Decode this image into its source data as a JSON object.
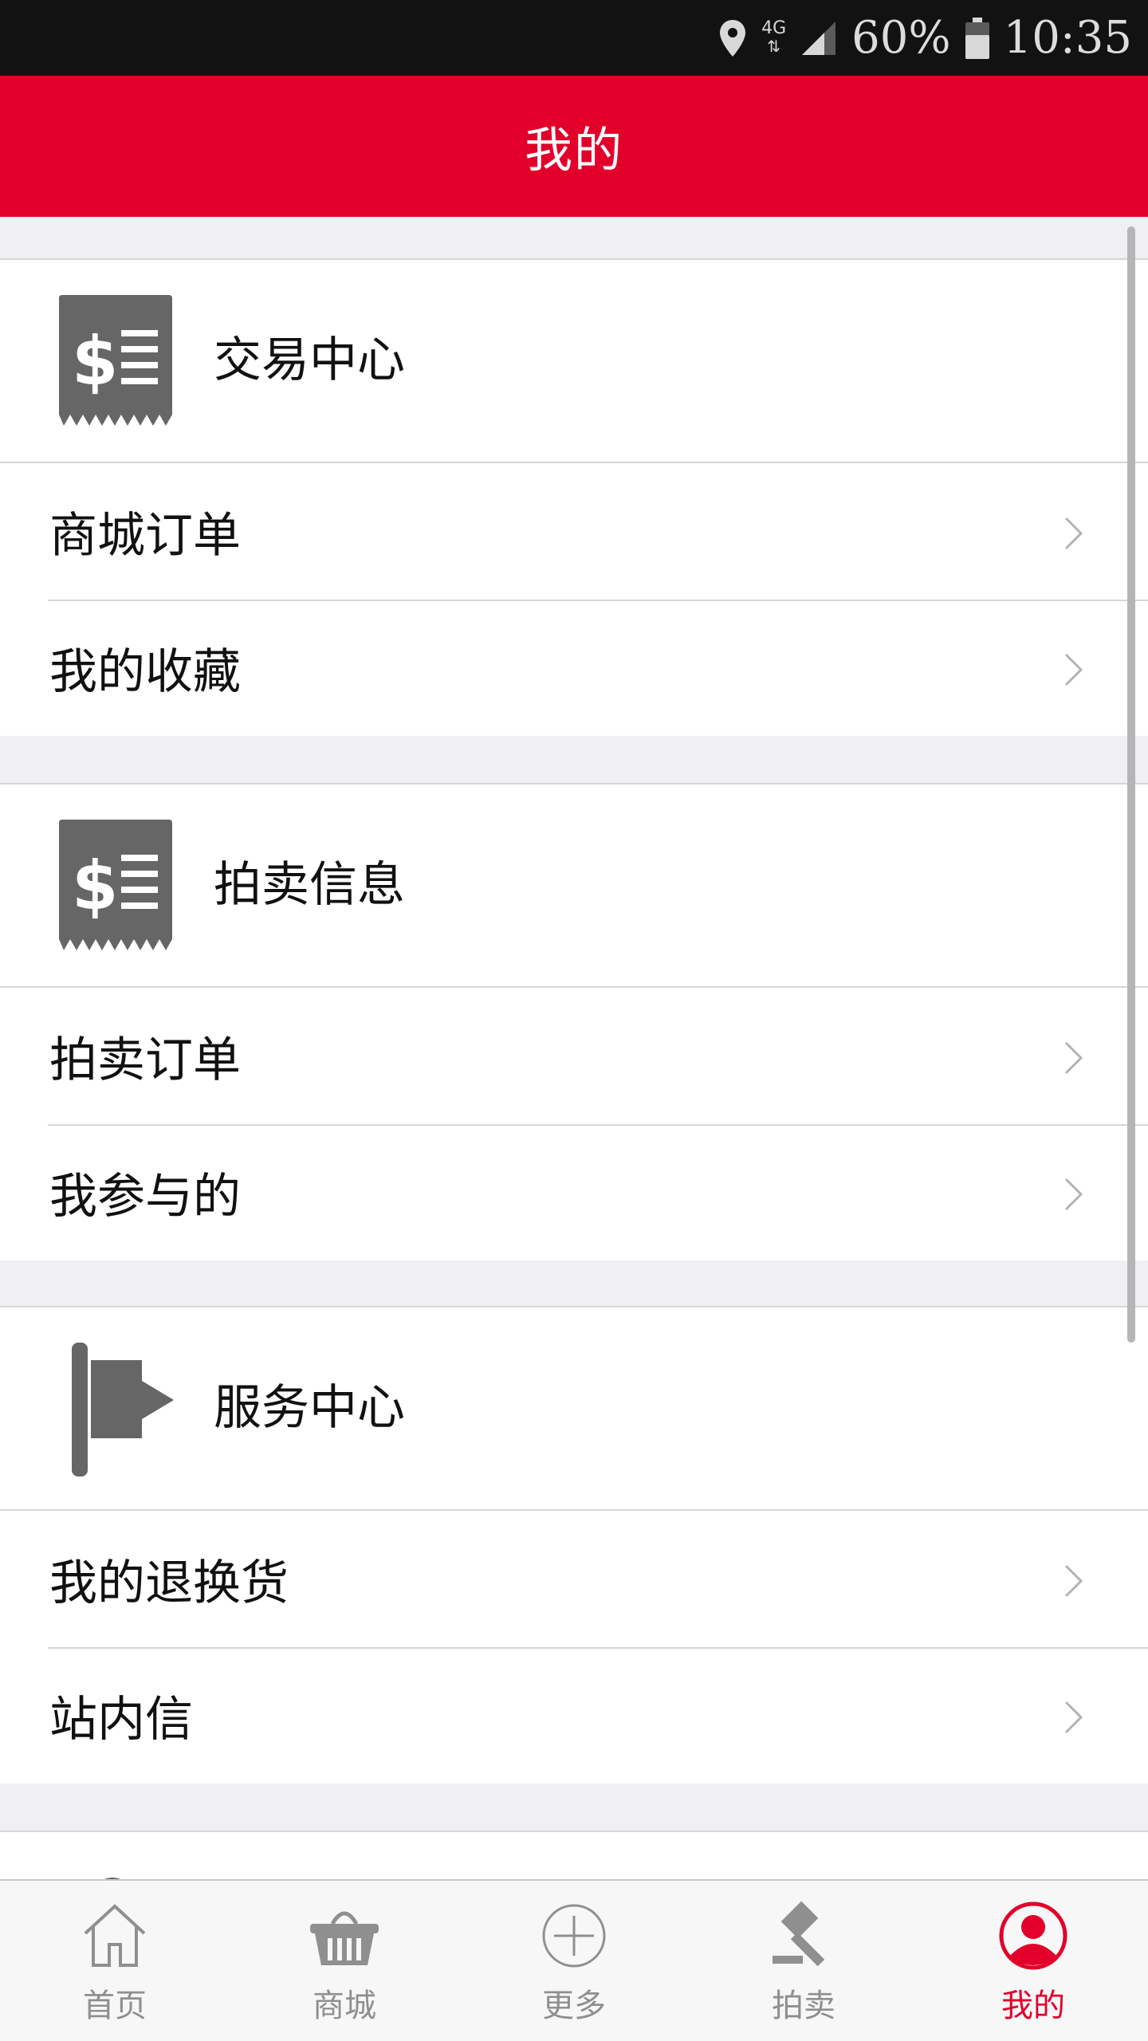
{
  "status_bar": {
    "network": "4G",
    "battery": "60%",
    "time": "10:35"
  },
  "header": {
    "title": "我的"
  },
  "sections": [
    {
      "title": "交易中心",
      "icon": "receipt-icon",
      "items": [
        {
          "label": "商城订单"
        },
        {
          "label": "我的收藏"
        }
      ]
    },
    {
      "title": "拍卖信息",
      "icon": "receipt-icon",
      "items": [
        {
          "label": "拍卖订单"
        },
        {
          "label": "我参与的"
        }
      ]
    },
    {
      "title": "服务中心",
      "icon": "flag-icon",
      "items": [
        {
          "label": "我的退换货"
        },
        {
          "label": "站内信"
        }
      ]
    }
  ],
  "tab_bar": {
    "tabs": [
      {
        "label": "首页",
        "icon": "home-icon"
      },
      {
        "label": "商城",
        "icon": "basket-icon"
      },
      {
        "label": "更多",
        "icon": "plus-circle-icon"
      },
      {
        "label": "拍卖",
        "icon": "gavel-icon"
      },
      {
        "label": "我的",
        "icon": "user-icon",
        "active": true
      }
    ]
  },
  "colors": {
    "brand_red": "#e2002a",
    "icon_gray": "#666666",
    "background": "#efeff4"
  }
}
